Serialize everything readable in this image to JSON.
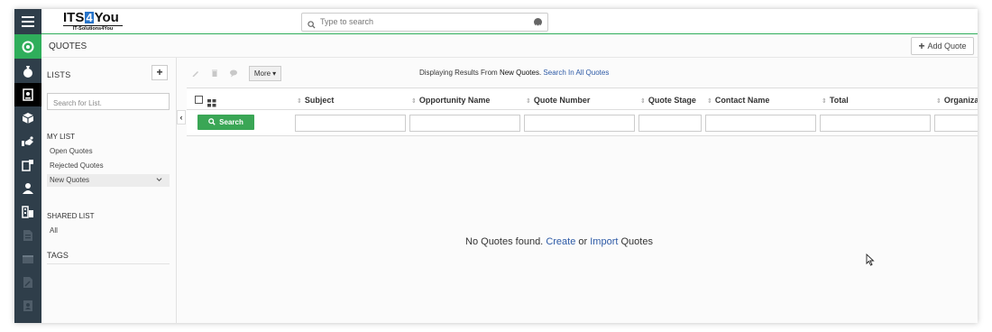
{
  "brand": {
    "name_part1": "ITS",
    "name_box": "4",
    "name_part2": "You",
    "tagline": "IT-Solutions4You"
  },
  "header": {
    "search_placeholder": "Type to search"
  },
  "module": {
    "title": "QUOTES",
    "add_button": "Add Quote"
  },
  "sidebar": {
    "lists_heading": "LISTS",
    "add_list_symbol": "+",
    "search_placeholder": "Search for List.",
    "my_list_heading": "MY LIST",
    "my_list_items": [
      "Open Quotes",
      "Rejected Quotes",
      "New Quotes"
    ],
    "shared_list_heading": "SHARED LIST",
    "shared_list_items": [
      "All"
    ],
    "tags_heading": "TAGS"
  },
  "toolbar": {
    "more_label": "More",
    "displaying_prefix": "Displaying Results From",
    "displaying_list": "New Quotes.",
    "search_all_link": "Search In All Quotes"
  },
  "table": {
    "columns": [
      "Subject",
      "Opportunity Name",
      "Quote Number",
      "Quote Stage",
      "Contact Name",
      "Total",
      "Organization"
    ],
    "search_button": "Search"
  },
  "empty_state": {
    "prefix": "No Quotes found.",
    "create_link": "Create",
    "or": "or",
    "import_link": "Import",
    "suffix": "Quotes"
  },
  "colors": {
    "accent": "#2fae5b",
    "iconbar": "#2f3e4a",
    "link": "#2d5aa6",
    "brand_box": "#2673c9"
  }
}
